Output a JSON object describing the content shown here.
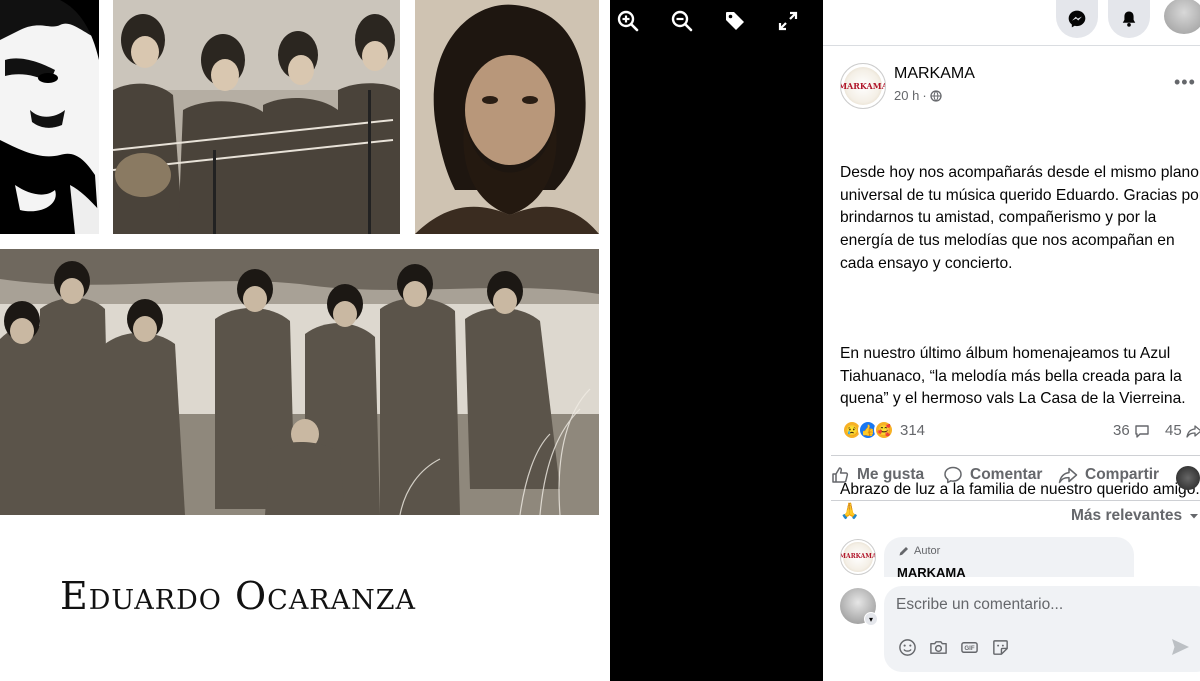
{
  "viewer": {
    "tools": [
      {
        "icon": "zoom-in-icon"
      },
      {
        "icon": "zoom-out-icon"
      },
      {
        "icon": "tag-icon"
      },
      {
        "icon": "fullscreen-icon"
      }
    ],
    "caption": "Eduardo Ocaranza"
  },
  "topbar": {
    "messenger_icon": "messenger-icon",
    "notifications_icon": "bell-icon",
    "profile_icon": "profile-avatar"
  },
  "post": {
    "page_name": "MARKAMA",
    "logo_text": "MARKAMA",
    "time": "20 h",
    "separator": "·",
    "privacy_icon": "globe-icon",
    "more_label": "•••",
    "paragraphs": [
      "Desde hoy nos acompañarás desde el mismo plano universal de tu música querido Eduardo. Gracias por brindarnos tu amistad, compañerismo y por la energía de tus melodías que nos acompañan en cada ensayo y concierto.",
      "En nuestro último álbum homenajeamos tu Azul Tiahuanaco, “la melodía más bella creada para la quena” y el hermoso vals La Casa de la Vierreina.",
      "Abrazo de luz a la familia de nuestro querido amigo. 🙏"
    ],
    "reactions": {
      "emojis": [
        "😢",
        "👍",
        "🥰"
      ],
      "count": "314"
    },
    "comments_count": "36",
    "shares_count": "45"
  },
  "actions": {
    "like": "Me gusta",
    "comment": "Comentar",
    "share": "Compartir"
  },
  "sort": {
    "label": "Más relevantes"
  },
  "comments": [
    {
      "badge": "Autor",
      "author": "MARKAMA"
    }
  ],
  "composer": {
    "placeholder": "Escribe un comentario...",
    "tools": [
      "emoji-icon",
      "camera-icon",
      "gif-icon",
      "sticker-icon"
    ],
    "send_icon": "send-icon"
  },
  "colors": {
    "accent_blue": "#1877f2",
    "secondary_text": "#65676b",
    "primary_text": "#050505",
    "comment_bg": "#f0f2f5",
    "logo_red": "#b0162a"
  }
}
